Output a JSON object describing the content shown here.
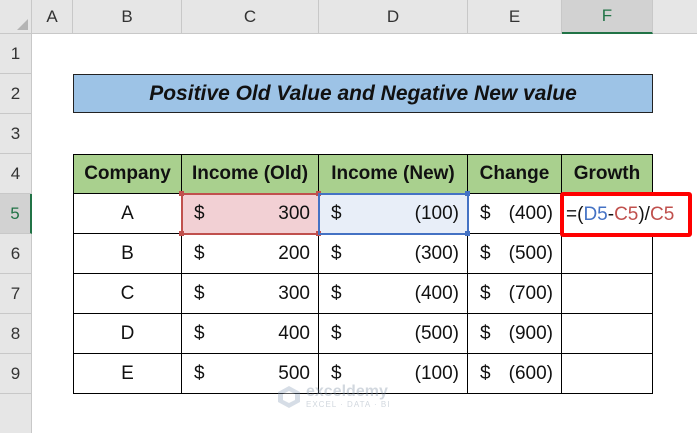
{
  "columns": [
    "A",
    "B",
    "C",
    "D",
    "E",
    "F"
  ],
  "rows": [
    "1",
    "2",
    "3",
    "4",
    "5",
    "6",
    "7",
    "8",
    "9"
  ],
  "title": "Positive Old Value and Negative New value",
  "headers": {
    "company": "Company",
    "income_old": "Income (Old)",
    "income_new": "Income (New)",
    "change": "Change",
    "growth": "Growth"
  },
  "currency": "$",
  "data": [
    {
      "company": "A",
      "old": "300",
      "new": "(100)",
      "change": "(400)"
    },
    {
      "company": "B",
      "old": "200",
      "new": "(300)",
      "change": "(500)"
    },
    {
      "company": "C",
      "old": "300",
      "new": "(400)",
      "change": "(700)"
    },
    {
      "company": "D",
      "old": "400",
      "new": "(500)",
      "change": "(900)"
    },
    {
      "company": "E",
      "old": "500",
      "new": "(100)",
      "change": "(600)"
    }
  ],
  "formula": {
    "eq_open": "=(",
    "ref1": "D5",
    "minus": "-",
    "ref2": "C5",
    "close_div": ")/",
    "ref3": "C5"
  },
  "watermark": {
    "main": "exceldemy",
    "sub": "EXCEL · DATA · BI"
  },
  "colors": {
    "header_fill": "#a9d08e",
    "title_fill": "#9dc3e6",
    "old_ref_fill": "#f2d0d4",
    "new_ref_fill": "#e8eef8",
    "highlight_border": "#ff0000",
    "ref_blue": "#4472c4",
    "ref_red": "#c0504d"
  }
}
